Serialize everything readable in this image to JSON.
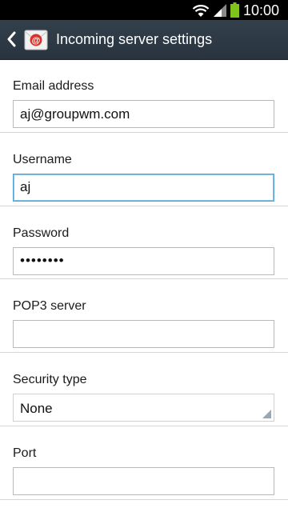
{
  "status_bar": {
    "time": "10:00",
    "icons": [
      "wifi-icon",
      "signal-icon",
      "battery-icon"
    ],
    "battery_color": "#7fc31c"
  },
  "action_bar": {
    "title": "Incoming server settings",
    "back_icon": "chevron-left-icon",
    "app_icon": "email-icon",
    "background_color": "#2e3a46"
  },
  "form": {
    "email": {
      "label": "Email address",
      "value": "aj@groupwm.com"
    },
    "username": {
      "label": "Username",
      "value": "aj"
    },
    "password": {
      "label": "Password",
      "value": "••••••••"
    },
    "pop3": {
      "label": "POP3 server",
      "value": ""
    },
    "security": {
      "label": "Security type",
      "value": "None"
    },
    "port": {
      "label": "Port",
      "value": ""
    }
  },
  "colors": {
    "focus_border": "#56a5d8",
    "divider": "#d6d6d6"
  }
}
